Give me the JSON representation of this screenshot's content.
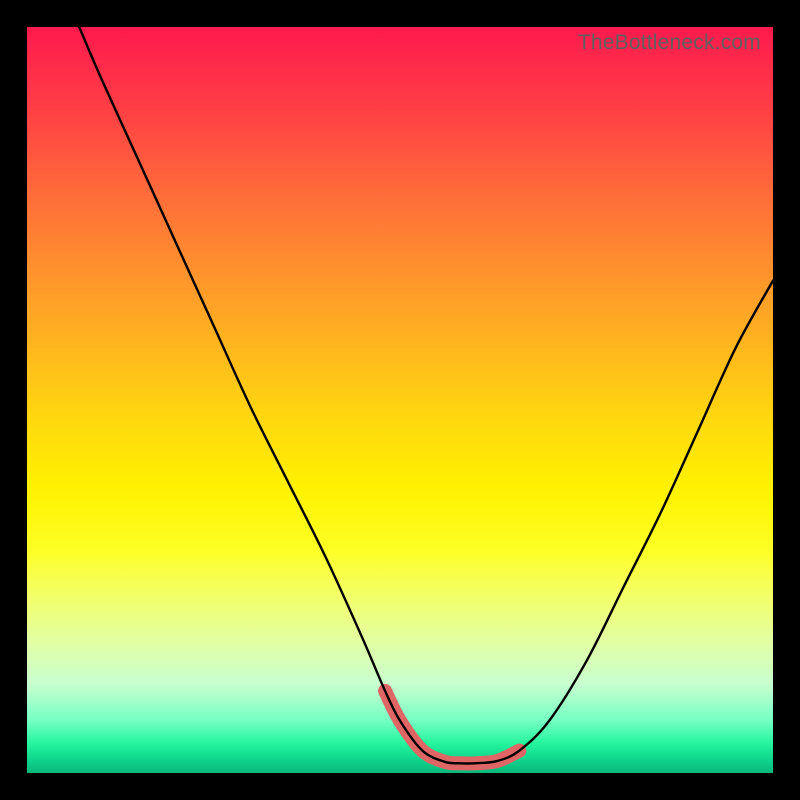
{
  "watermark": "TheBottleneck.com",
  "chart_data": {
    "type": "line",
    "title": "",
    "xlabel": "",
    "ylabel": "",
    "xlim": [
      0,
      100
    ],
    "ylim": [
      0,
      100
    ],
    "grid": false,
    "series": [
      {
        "name": "bottleneck-curve",
        "color": "#000000",
        "x": [
          7,
          10,
          15,
          20,
          25,
          30,
          35,
          40,
          45,
          48,
          50,
          53,
          56,
          58,
          60,
          63,
          66,
          70,
          75,
          80,
          85,
          90,
          95,
          100
        ],
        "y": [
          100,
          93,
          82,
          71,
          60,
          49,
          39,
          29,
          18,
          11,
          7,
          3,
          1.5,
          1.3,
          1.3,
          1.6,
          3,
          7,
          15,
          25,
          35,
          46,
          57,
          66
        ]
      },
      {
        "name": "optimal-range",
        "color": "#e06666",
        "x": [
          48,
          50,
          53,
          56,
          58,
          60,
          63,
          66
        ],
        "y": [
          11,
          7,
          3,
          1.5,
          1.3,
          1.3,
          1.6,
          3
        ]
      }
    ]
  }
}
